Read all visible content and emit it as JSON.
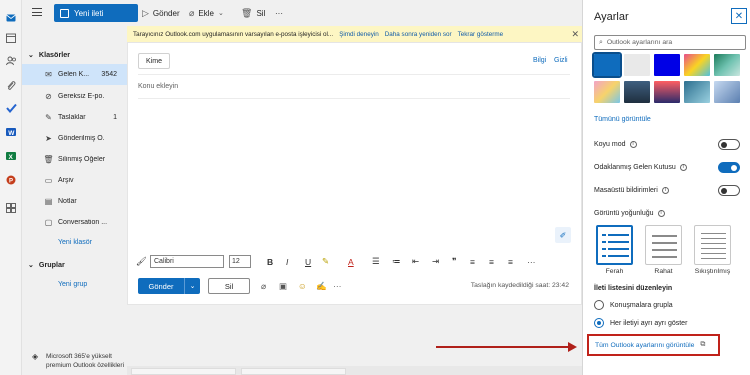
{
  "toolbar": {
    "new_mail": "Yeni ileti",
    "send": "Gönder",
    "attach": "Ekle",
    "delete": "Sil",
    "more": "···"
  },
  "banner": {
    "text": "Tarayıcınız Outlook.com uygulamasının varsayılan e-posta işleyicisi ol...",
    "try_now": "Şimdi deneyin",
    "ask_later": "Daha sonra yeniden sor",
    "never_show": "Tekrar gösterme"
  },
  "folders": {
    "header": "Klasörler",
    "items": [
      {
        "label": "Gelen K...",
        "count": "3542",
        "icon": "inbox-icon"
      },
      {
        "label": "Gereksiz E-po...",
        "count": "",
        "icon": "junk-icon"
      },
      {
        "label": "Taslaklar",
        "count": "1",
        "icon": "drafts-icon"
      },
      {
        "label": "Gönderilmiş Ö...",
        "count": "",
        "icon": "sent-icon"
      },
      {
        "label": "Silinmiş Öğeler",
        "count": "",
        "icon": "trash-icon"
      },
      {
        "label": "Arşiv",
        "count": "",
        "icon": "archive-icon"
      },
      {
        "label": "Notlar",
        "count": "",
        "icon": "notes-icon"
      },
      {
        "label": "Conversation ...",
        "count": "",
        "icon": "folder-icon"
      }
    ],
    "new_folder": "Yeni klasör",
    "groups_header": "Gruplar",
    "new_group": "Yeni grup",
    "premium": "Microsoft 365'e yükselt premium Outlook özellikleri"
  },
  "compose": {
    "to": "Kime",
    "cc": "Bilgi",
    "bcc": "Gizli",
    "subject_placeholder": "Konu ekleyin",
    "font": "Calibri",
    "size": "12",
    "send": "Gönder",
    "discard": "Sil",
    "saved": "Taslağın kaydedildiği saat: 23:42"
  },
  "settings": {
    "title": "Ayarlar",
    "search_placeholder": "Outlook ayarlarını ara",
    "show_all_themes": "Tümünü görüntüle",
    "dark_mode": "Koyu mod",
    "focused_inbox": "Odaklanmış Gelen Kutusu",
    "desktop_notifications": "Masaüstü bildirimleri",
    "density_title": "Görüntü yoğunluğu",
    "density_options": [
      "Ferah",
      "Rahat",
      "Sıkıştırılmış"
    ],
    "conversation_title": "İleti listesini düzenleyin",
    "group_conversations": "Konuşmalara grupla",
    "separate_messages": "Her iletiyi ayrı ayrı göster",
    "all_settings": "Tüm Outlook ayarlarını görüntüle",
    "dark_mode_on": false,
    "focused_inbox_on": true,
    "desktop_notifications_on": false
  },
  "colors": {
    "accent": "#0f6cbd",
    "highlight": "#c0221a"
  }
}
